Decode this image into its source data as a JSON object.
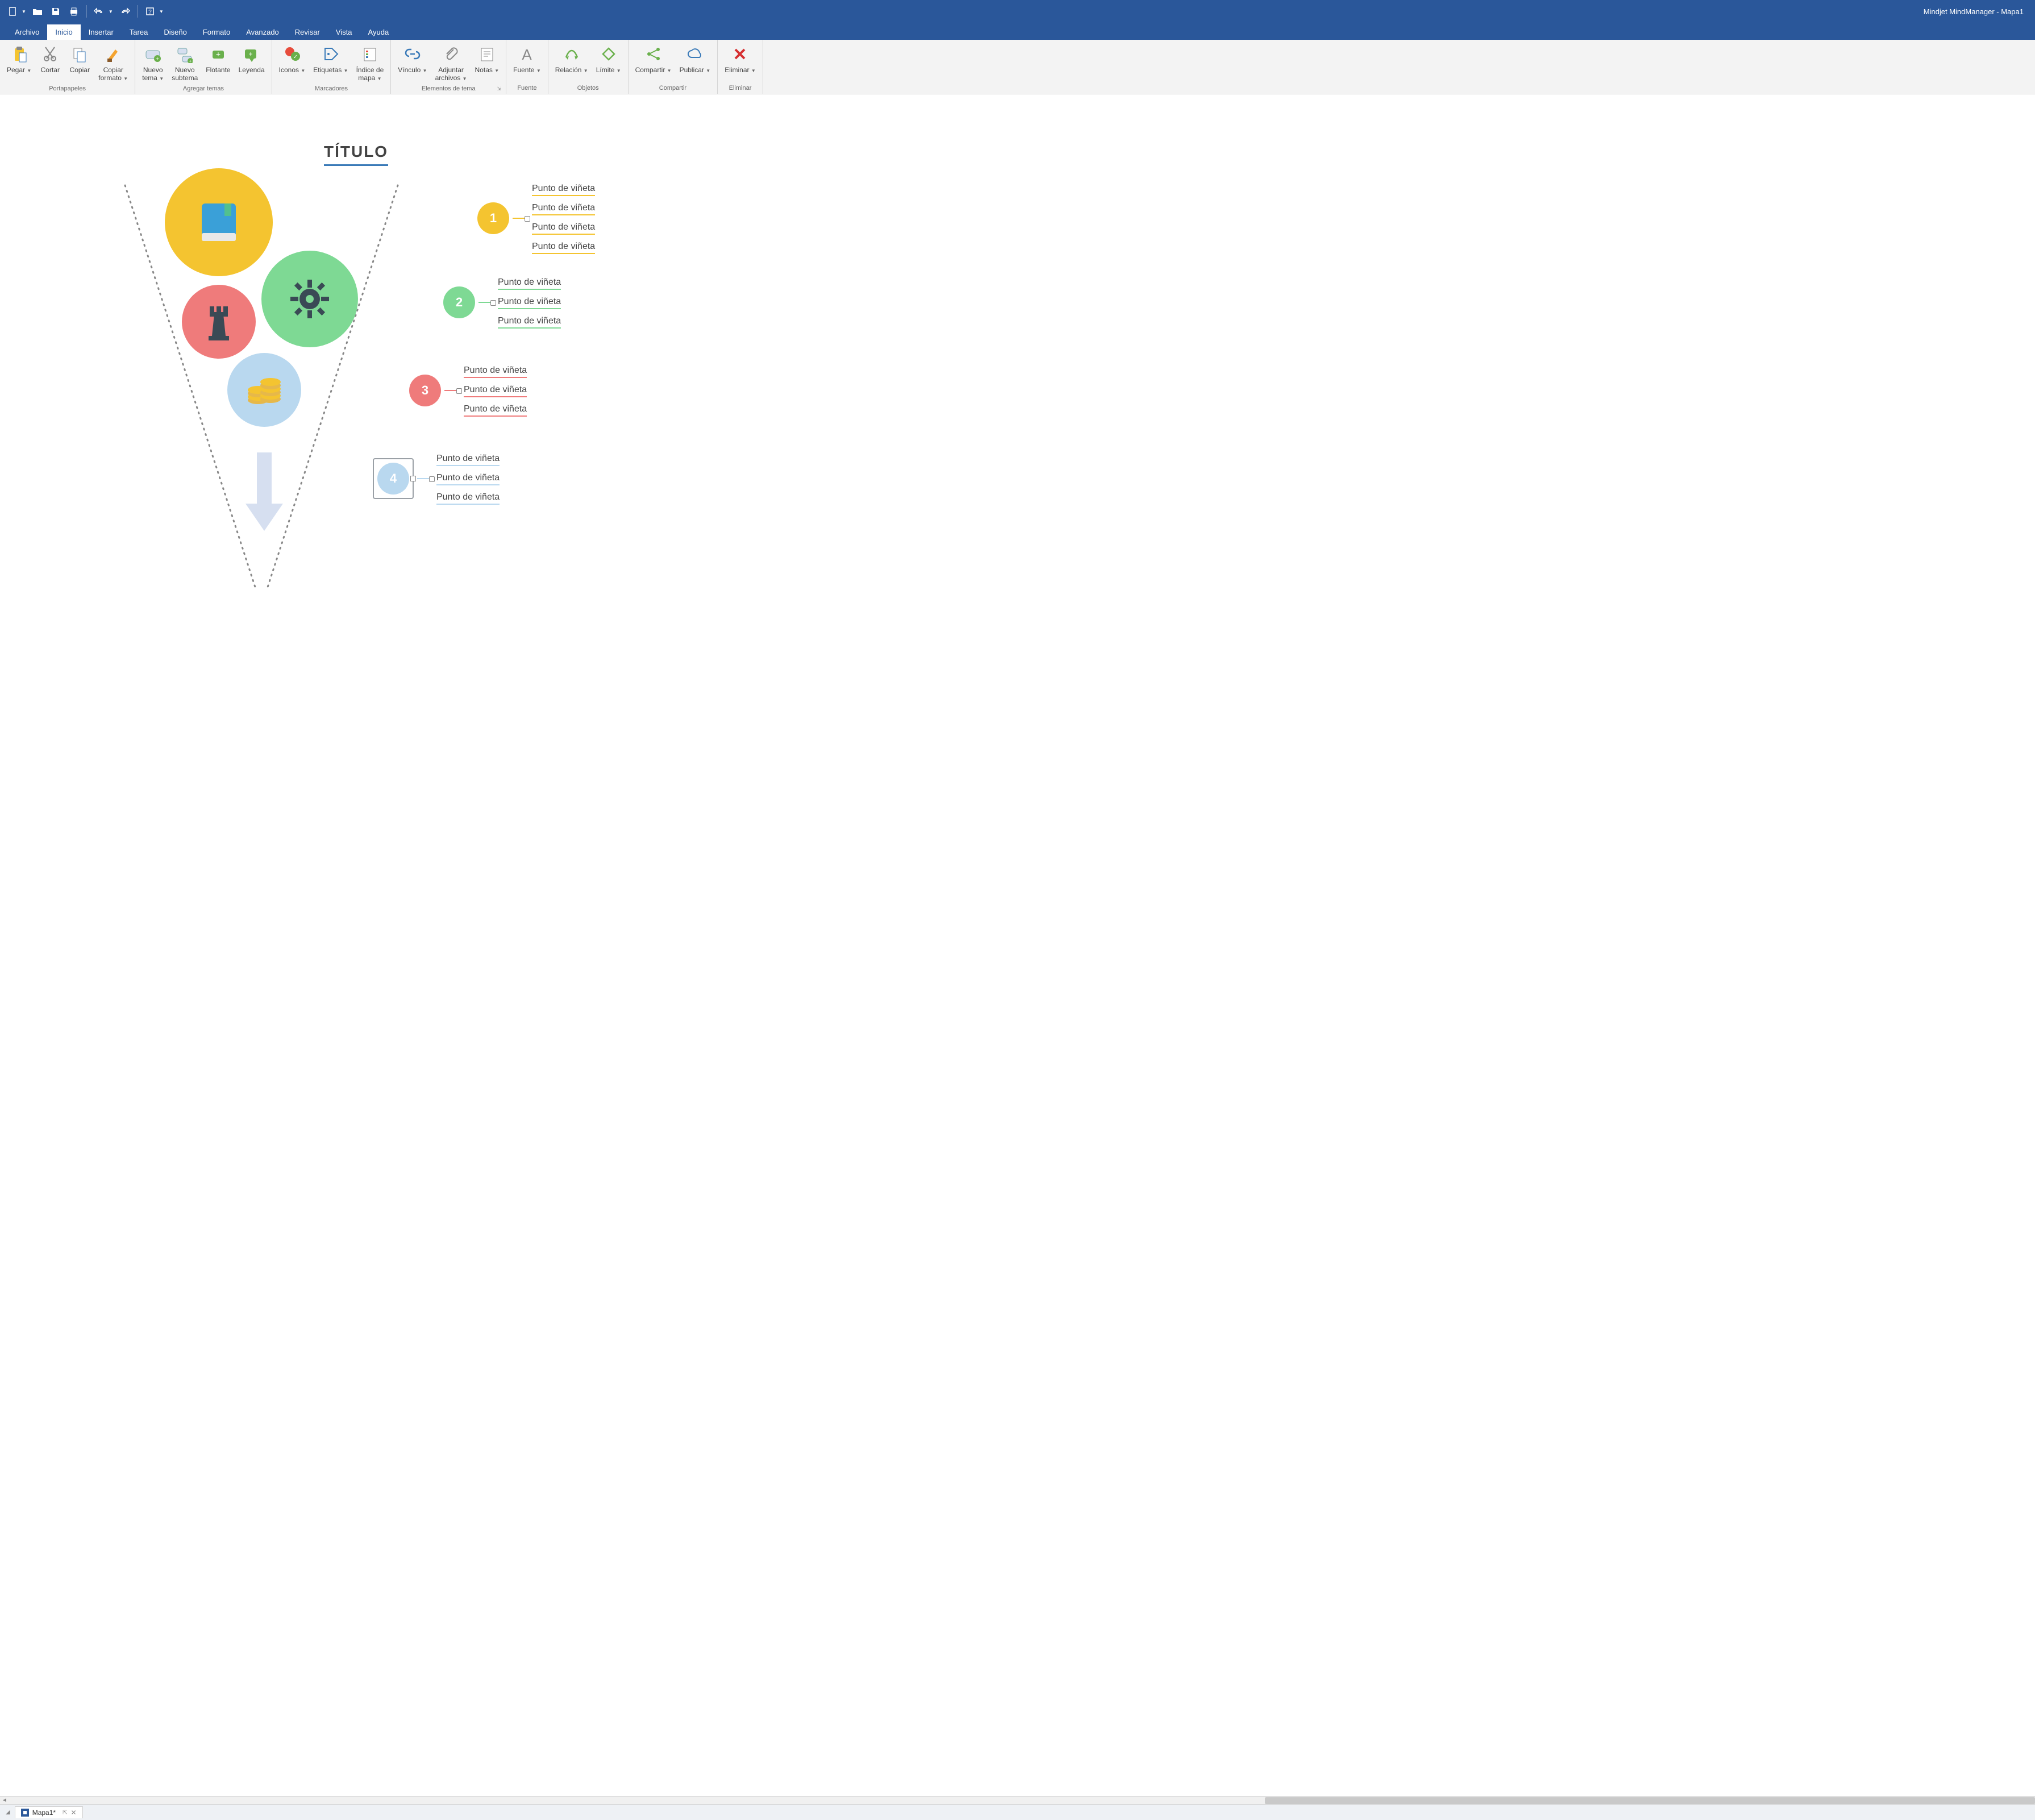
{
  "app_title": "Mindjet MindManager - Mapa1",
  "qat": {
    "new": "new-doc",
    "open": "open",
    "save": "save",
    "print": "print",
    "undo": "undo",
    "redo": "redo",
    "help": "help"
  },
  "tabs": [
    "Archivo",
    "Inicio",
    "Insertar",
    "Tarea",
    "Diseño",
    "Formato",
    "Avanzado",
    "Revisar",
    "Vista",
    "Ayuda"
  ],
  "active_tab": 1,
  "ribbon": {
    "groups": [
      {
        "label": "Portapapeles",
        "items": [
          {
            "id": "pegar",
            "label": "Pegar",
            "drop": true,
            "icon": "paste"
          },
          {
            "id": "cortar",
            "label": "Cortar",
            "icon": "cut"
          },
          {
            "id": "copiar",
            "label": "Copiar",
            "icon": "copy"
          },
          {
            "id": "copiar-formato",
            "label": "Copiar\nformato ",
            "drop": true,
            "icon": "brush"
          }
        ]
      },
      {
        "label": "Agregar temas",
        "items": [
          {
            "id": "nuevo-tema",
            "label": "Nuevo\ntema ",
            "drop": true,
            "icon": "topic-plus"
          },
          {
            "id": "nuevo-subtema",
            "label": "Nuevo\nsubtema",
            "icon": "subtopic-plus"
          },
          {
            "id": "flotante",
            "label": "Flotante",
            "icon": "float-plus"
          },
          {
            "id": "leyenda",
            "label": "Leyenda",
            "icon": "legend-plus"
          }
        ]
      },
      {
        "label": "Marcadores",
        "items": [
          {
            "id": "iconos",
            "label": "Iconos",
            "drop": true,
            "icon": "icons"
          },
          {
            "id": "etiquetas",
            "label": "Etiquetas",
            "drop": true,
            "icon": "tag"
          },
          {
            "id": "indice",
            "label": "Índice de\nmapa ",
            "drop": true,
            "icon": "index"
          }
        ]
      },
      {
        "label": "Elementos de tema",
        "launcher": true,
        "items": [
          {
            "id": "vinculo",
            "label": "Vínculo",
            "drop": true,
            "icon": "link"
          },
          {
            "id": "adjuntar",
            "label": "Adjuntar\narchivos ",
            "drop": true,
            "icon": "attach"
          },
          {
            "id": "notas",
            "label": "Notas",
            "drop": true,
            "icon": "notes"
          }
        ]
      },
      {
        "label": "Fuente",
        "items": [
          {
            "id": "fuente",
            "label": "Fuente",
            "drop": true,
            "icon": "font"
          }
        ]
      },
      {
        "label": "Objetos",
        "items": [
          {
            "id": "relacion",
            "label": "Relación",
            "drop": true,
            "icon": "relation"
          },
          {
            "id": "limite",
            "label": "Límite",
            "drop": true,
            "icon": "boundary"
          }
        ]
      },
      {
        "label": "Compartir",
        "items": [
          {
            "id": "compartir",
            "label": "Compartir",
            "drop": true,
            "icon": "share"
          },
          {
            "id": "publicar",
            "label": "Publicar",
            "drop": true,
            "icon": "cloud"
          }
        ]
      },
      {
        "label": "Eliminar",
        "items": [
          {
            "id": "eliminar",
            "label": "Eliminar",
            "drop": true,
            "icon": "delete"
          }
        ]
      }
    ]
  },
  "map": {
    "title": "TÍTULO",
    "sections": [
      {
        "num": "1",
        "color": "#f4c430",
        "bullets": [
          "Punto de viñeta",
          "Punto de viñeta",
          "Punto de viñeta",
          "Punto de viñeta"
        ]
      },
      {
        "num": "2",
        "color": "#7ed994",
        "bullets": [
          "Punto de viñeta",
          "Punto de viñeta",
          "Punto de viñeta"
        ]
      },
      {
        "num": "3",
        "color": "#ef7b7b",
        "bullets": [
          "Punto de viñeta",
          "Punto de viñeta",
          "Punto de viñeta"
        ]
      },
      {
        "num": "4",
        "color": "#b9d8ef",
        "bullets": [
          "Punto de viñeta",
          "Punto de viñeta",
          "Punto de viñeta"
        ],
        "selected": true
      }
    ]
  },
  "doc_tab": {
    "name": "Mapa1*"
  }
}
